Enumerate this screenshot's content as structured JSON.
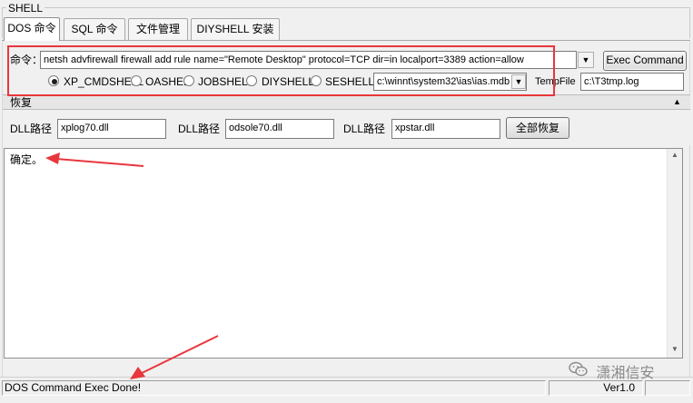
{
  "group": {
    "title": "SHELL"
  },
  "tabs": [
    {
      "label": "DOS 命令"
    },
    {
      "label": "SQL 命令"
    },
    {
      "label": "文件管理"
    },
    {
      "label": "DIYSHELL 安装"
    }
  ],
  "command": {
    "label": "命令：",
    "value": "netsh advfirewall firewall add rule name=\"Remote Desktop\" protocol=TCP dir=in localport=3389 action=allow",
    "exec_label": "Exec Command"
  },
  "shell_options": {
    "selected": "XP_CMDSHELL",
    "items": [
      "XP_CMDSHELL",
      "OASHEL",
      "JOBSHELL",
      "DIYSHELL",
      "SESHELL"
    ],
    "mdb_path": "c:\\winnt\\system32\\ias\\ias.mdb",
    "temp_label": "TempFile",
    "temp_value": "c:\\T3tmp.log"
  },
  "restore": {
    "section_label": "恢复",
    "dll_label": "DLL路径",
    "dll_paths": [
      "xplog70.dll",
      "odsole70.dll",
      "xpstar.dll"
    ],
    "restore_all_label": "全部恢复"
  },
  "output": {
    "text": "确定。"
  },
  "status": {
    "message": "DOS Command Exec Done!",
    "version": "Ver1.0"
  },
  "watermark": {
    "text": "潇湘信安"
  },
  "colors": {
    "annotation_red": "#e8363c"
  }
}
